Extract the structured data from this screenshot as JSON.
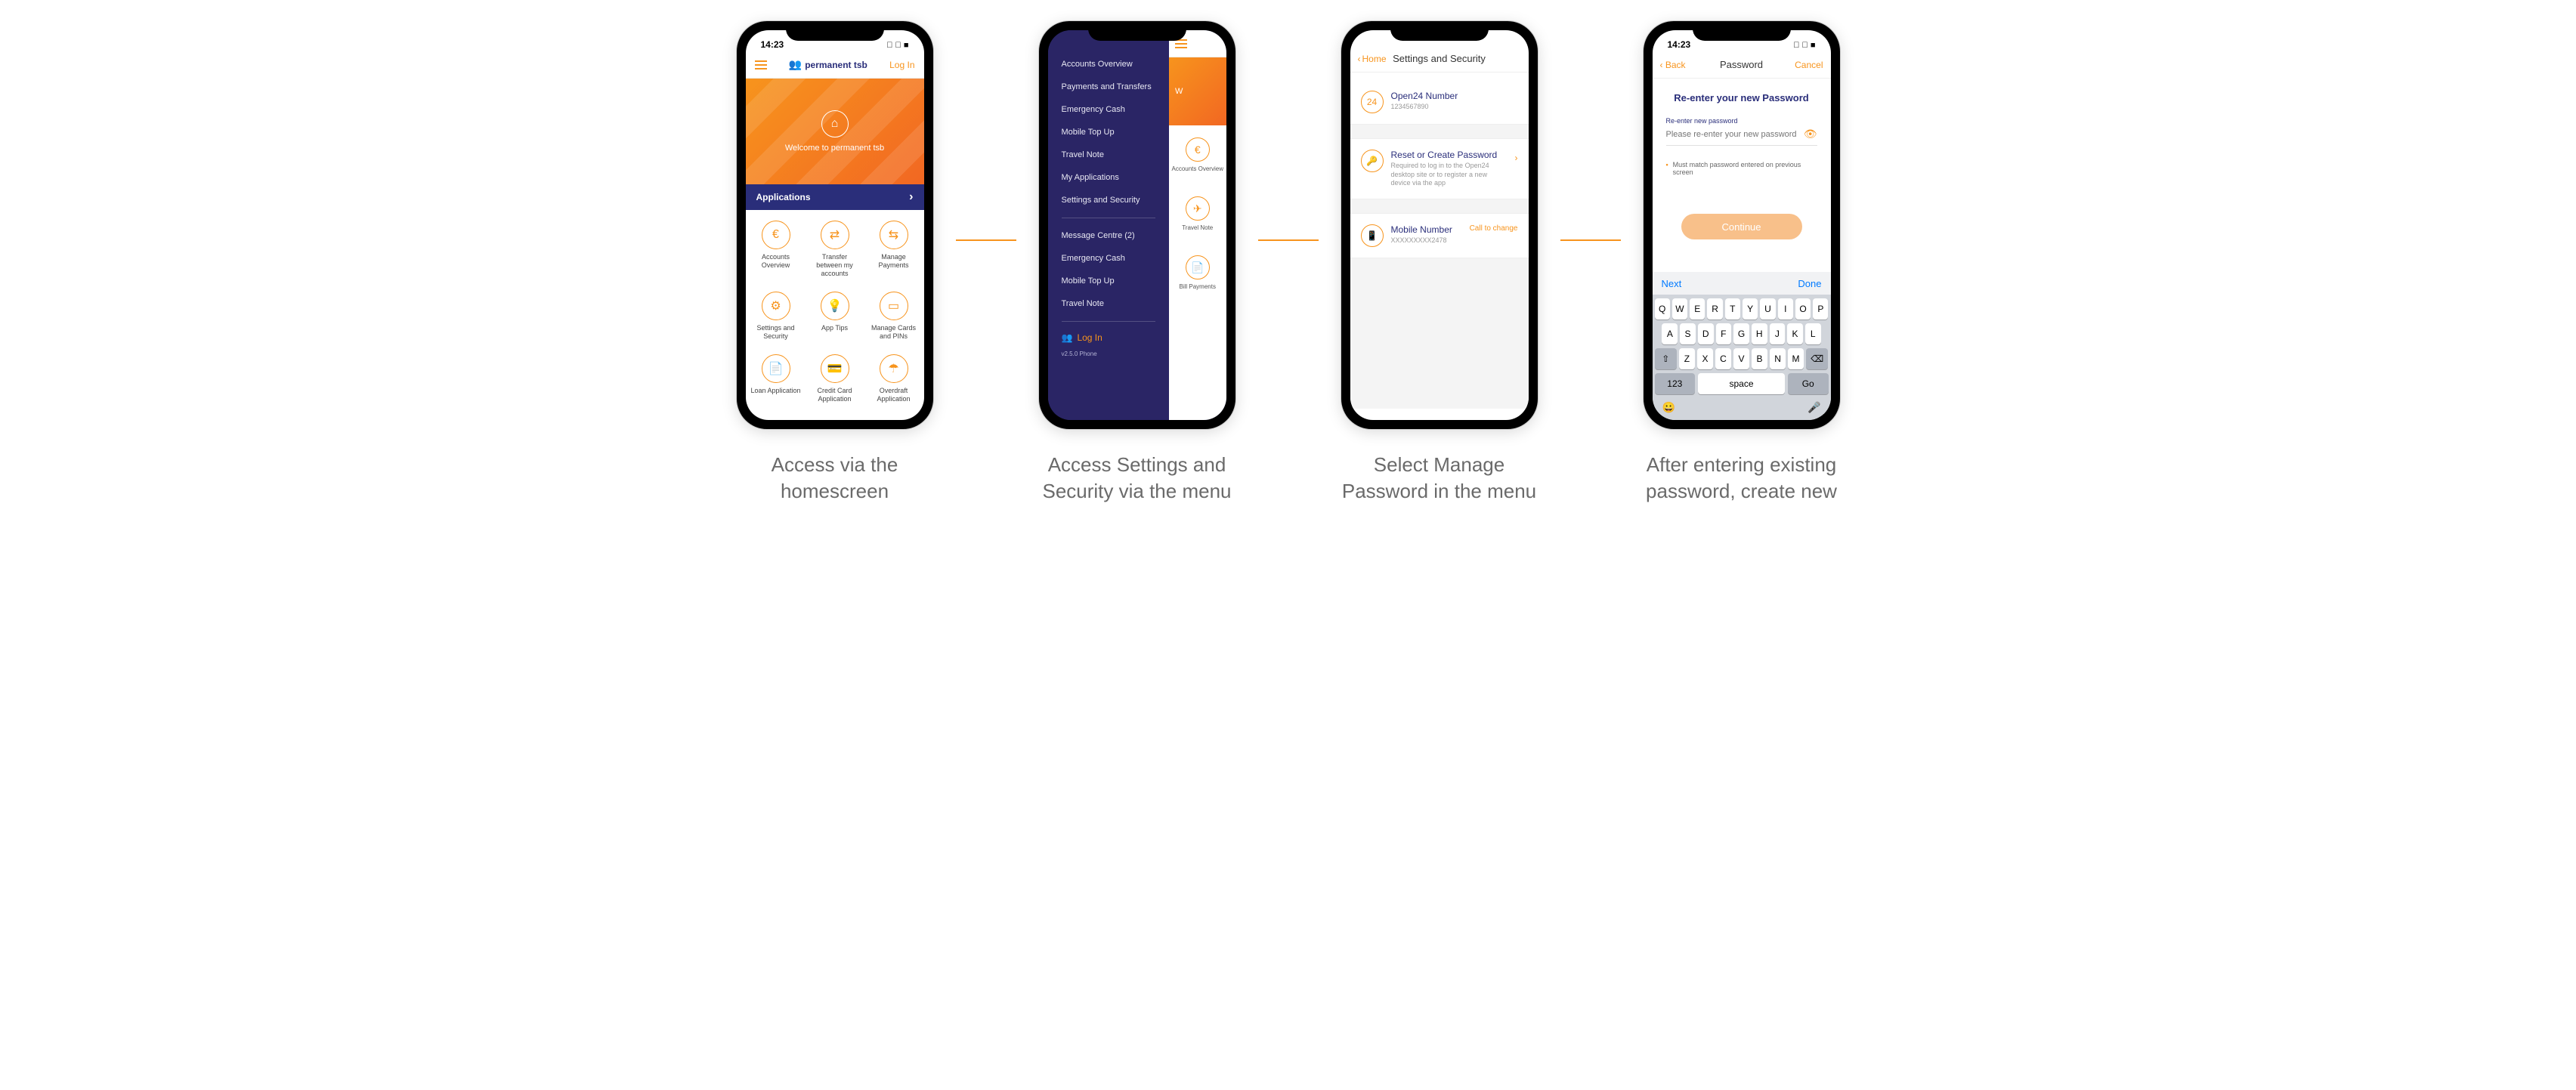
{
  "status": {
    "time": "14:23",
    "signal": "􀙇",
    "wifi": "􀙈",
    "battery": "􀛨"
  },
  "screen1": {
    "login": "Log In",
    "logo_text": "permanent tsb",
    "hero": "Welcome to permanent tsb",
    "band": "Applications",
    "tiles": [
      {
        "label": "Accounts Overview",
        "glyph": "€"
      },
      {
        "label": "Transfer between my accounts",
        "glyph": "⇄"
      },
      {
        "label": "Manage Payments",
        "glyph": "⇆"
      },
      {
        "label": "Settings and Security",
        "glyph": "⚙"
      },
      {
        "label": "App Tips",
        "glyph": "💡"
      },
      {
        "label": "Manage Cards and PINs",
        "glyph": "▭"
      },
      {
        "label": "Loan Application",
        "glyph": "📄"
      },
      {
        "label": "Credit Card Application",
        "glyph": "💳"
      },
      {
        "label": "Overdraft Application",
        "glyph": "☂"
      }
    ]
  },
  "screen2": {
    "menu": [
      "Accounts Overview",
      "Payments and Transfers",
      "Emergency Cash",
      "Mobile Top Up",
      "Travel Note",
      "My Applications",
      "Settings and Security"
    ],
    "menu2": [
      "Message Centre (2)",
      "Emergency Cash",
      "Mobile Top Up",
      "Travel Note"
    ],
    "login": "Log In",
    "version": "v2.5.0 Phone",
    "peek_tiles": [
      {
        "label": "Accounts Overview",
        "glyph": "€"
      },
      {
        "label": "Travel Note",
        "glyph": "✈"
      },
      {
        "label": "Bill Payments",
        "glyph": "📄"
      }
    ],
    "peek_hero_w": "W"
  },
  "screen3": {
    "back": "Home",
    "title": "Settings and Security",
    "items": [
      {
        "icon": "24",
        "title": "Open24 Number",
        "sub": "1234567890",
        "chev": false
      },
      {
        "icon": "🔑",
        "title": "Reset or Create Password",
        "sub": "Required to log in to the Open24 desktop site or to register a new device via the app",
        "chev": true
      },
      {
        "icon": "📱",
        "title": "Mobile Number",
        "sub": "XXXXXXXXX2478",
        "cta": "Call to change"
      }
    ]
  },
  "screen4": {
    "back": "Back",
    "cancel": "Cancel",
    "title": "Password",
    "heading": "Re-enter your new Password",
    "field_label": "Re-enter new password",
    "placeholder": "Please re-enter your new password",
    "requirement": "Must match password entered on previous screen",
    "continue": "Continue",
    "kb": {
      "next": "Next",
      "done": "Done",
      "row1": [
        "Q",
        "W",
        "E",
        "R",
        "T",
        "Y",
        "U",
        "I",
        "O",
        "P"
      ],
      "row2": [
        "A",
        "S",
        "D",
        "F",
        "G",
        "H",
        "J",
        "K",
        "L"
      ],
      "row3_shift": "⇧",
      "row3": [
        "Z",
        "X",
        "C",
        "V",
        "B",
        "N",
        "M"
      ],
      "row3_del": "⌫",
      "num": "123",
      "space": "space",
      "go": "Go",
      "emoji": "😀",
      "mic": "🎤"
    }
  },
  "captions": [
    "Access via the homescreen",
    "Access Settings and Security via the menu",
    "Select Manage Password in the menu",
    "After entering existing password, create new"
  ]
}
